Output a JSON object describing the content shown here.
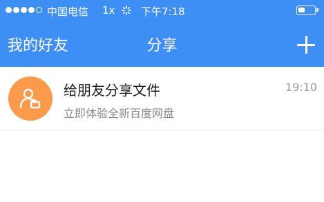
{
  "status_bar": {
    "carrier": "中国电信",
    "network": "1x",
    "time": "下午7:18"
  },
  "nav": {
    "left_label": "我的好友",
    "title": "分享",
    "add_icon": "plus-icon"
  },
  "share_list": [
    {
      "title": "给朋友分享文件",
      "subtitle": "立即体验全新百度网盘",
      "time": "19:10",
      "avatar_icon": "person-file-icon",
      "avatar_color": "#fa9a4a"
    }
  ],
  "colors": {
    "header": "#3d8ef5"
  }
}
